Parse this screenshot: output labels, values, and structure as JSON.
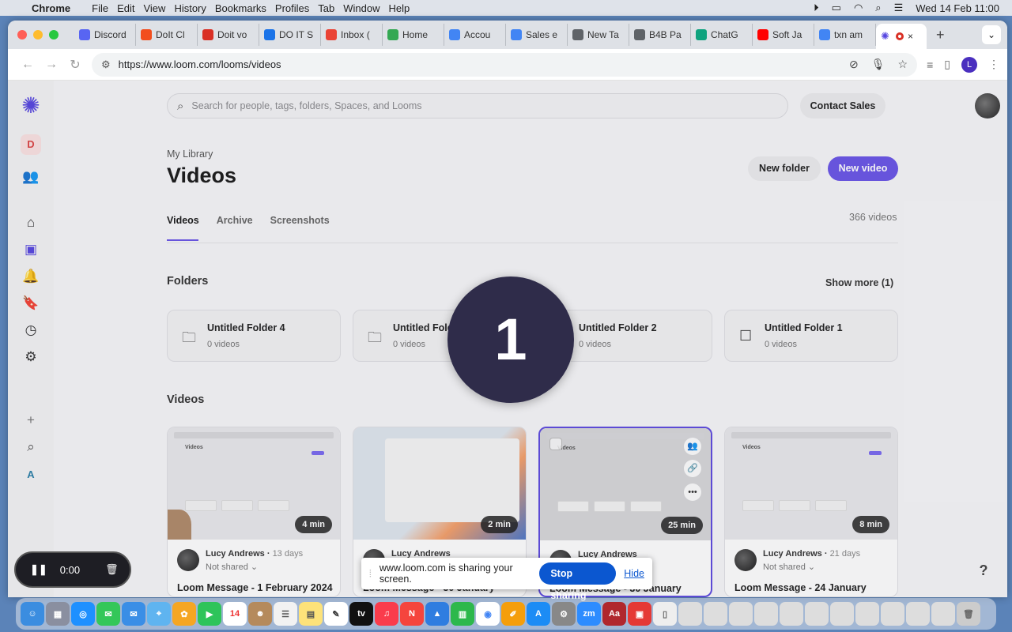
{
  "menubar": {
    "apple_glyph": "",
    "app": "Chrome",
    "items": [
      "File",
      "Edit",
      "View",
      "History",
      "Bookmarks",
      "Profiles",
      "Tab",
      "Window",
      "Help"
    ],
    "datetime": "Wed 14 Feb  11:00"
  },
  "browser": {
    "tabs": [
      {
        "label": "Discord",
        "color": "#5865f2"
      },
      {
        "label": "DoIt Cl",
        "color": "#f24e1e"
      },
      {
        "label": "Doit vo",
        "color": "#d93025"
      },
      {
        "label": "DO IT S",
        "color": "#1a73e8"
      },
      {
        "label": "Inbox (",
        "color": "#ea4335"
      },
      {
        "label": "Home",
        "color": "#34a853"
      },
      {
        "label": "Accou",
        "color": "#4285f4"
      },
      {
        "label": "Sales e",
        "color": "#4285f4"
      },
      {
        "label": "New Ta",
        "color": "#5f6368"
      },
      {
        "label": "B4B Pa",
        "color": "#5f6368"
      },
      {
        "label": "ChatG",
        "color": "#10a37f"
      },
      {
        "label": "Soft Ja",
        "color": "#ff0000"
      },
      {
        "label": "txn am",
        "color": "#4285f4"
      }
    ],
    "active_tab_close": "×",
    "new_tab": "+",
    "url": "https://www.loom.com/looms/videos",
    "profile_initial": "L"
  },
  "loom": {
    "workspace_initial": "D",
    "search_placeholder": "Search for people, tags, folders, Spaces, and Looms",
    "contact_sales": "Contact Sales",
    "breadcrumb": "My Library",
    "title": "Videos",
    "new_folder": "New folder",
    "new_video": "New video",
    "tabs": [
      "Videos",
      "Archive",
      "Screenshots"
    ],
    "video_count": "366 videos",
    "folders_heading": "Folders",
    "show_more": "Show more (1)",
    "folders": [
      {
        "name": "Untitled Folder 4",
        "count": "0 videos"
      },
      {
        "name": "Untitled Folder 3",
        "count": "0 videos"
      },
      {
        "name": "Untitled Folder 2",
        "count": "0 videos"
      },
      {
        "name": "Untitled Folder 1",
        "count": "0 videos"
      }
    ],
    "videos_heading": "Videos",
    "videos": [
      {
        "duration": "4 min",
        "author": "Lucy Andrews",
        "age": "13 days",
        "shared": "Not shared",
        "title": "Loom Message - 1 February 2024"
      },
      {
        "duration": "2 min",
        "author": "Lucy Andrews",
        "age": "",
        "shared": "",
        "title": "Loom Message - 30 January"
      },
      {
        "duration": "25 min",
        "author": "Lucy Andrews",
        "age": "",
        "shared": "",
        "title": "Loom Message - 30 January"
      },
      {
        "duration": "8 min",
        "author": "Lucy Andrews",
        "age": "21 days",
        "shared": "Not shared",
        "title": "Loom Message - 24 January"
      }
    ],
    "help": "?"
  },
  "countdown": "1",
  "recorder": {
    "time": "0:00"
  },
  "sharebar": {
    "message": "www.loom.com is sharing your screen.",
    "stop": "Stop sharing",
    "hide": "Hide"
  }
}
